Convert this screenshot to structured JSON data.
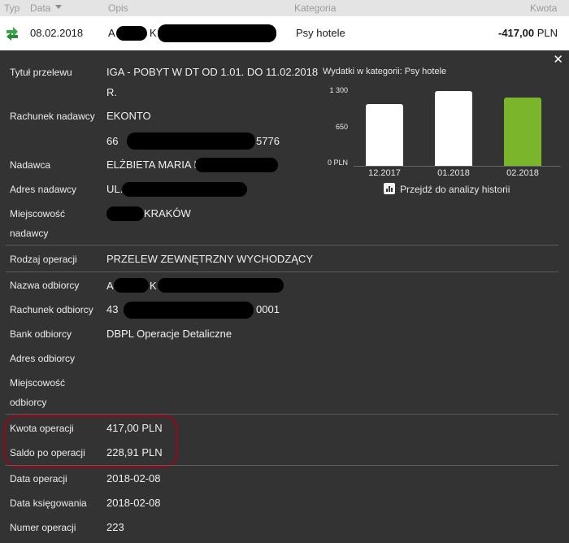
{
  "header": {
    "col_type": "Typ",
    "col_date": "Data",
    "col_desc": "Opis",
    "col_category": "Kategoria",
    "col_amount": "Kwota"
  },
  "transaction": {
    "date": "08.02.2018",
    "desc_start": "A",
    "desc_mid": "K",
    "category": "Psy hotele",
    "amount": "-417,00",
    "currency": "PLN"
  },
  "details": {
    "title_label": "Tytuł przelewu",
    "title_value_line1": "IGA - POBYT W DT OD 1.01. DO 11.02.2018",
    "title_value_line2": "R.",
    "sender_account_label": "Rachunek nadawcy",
    "sender_account_type": "EKONTO",
    "sender_account_prefix": "66",
    "sender_account_suffix": "5776",
    "sender_label": "Nadawca",
    "sender_value": "ELŻBIETA MARIA I",
    "sender_address_label": "Adres nadawcy",
    "sender_address_value": "UL.",
    "sender_city_label_1": "Miejscowość",
    "sender_city_label_2": "nadawcy",
    "sender_city_value": "KRAKÓW",
    "op_type_label": "Rodzaj operacji",
    "op_type_value": "PRZELEW ZEWNĘTRZNY WYCHODZĄCY",
    "recipient_name_label": "Nazwa odbiorcy",
    "recipient_name_a": "A",
    "recipient_name_k": "K",
    "recipient_account_label": "Rachunek odbiorcy",
    "recipient_account_prefix": "43",
    "recipient_account_suffix": "0001",
    "recipient_bank_label": "Bank odbiorcy",
    "recipient_bank_value": "DBPL Operacje Detaliczne",
    "recipient_address_label": "Adres odbiorcy",
    "recipient_city_label_1": "Miejscowość",
    "recipient_city_label_2": "odbiorcy",
    "amount_label": "Kwota operacji",
    "amount_value": "417,00 PLN",
    "balance_label": "Saldo po operacji",
    "balance_value": "228,91 PLN",
    "op_date_label": "Data operacji",
    "op_date_value": "2018-02-08",
    "booking_date_label": "Data księgowania",
    "booking_date_value": "2018-02-08",
    "op_number_label": "Numer operacji",
    "op_number_value": "223"
  },
  "chart_heading": "Wydatki w kategorii:  Psy hotele",
  "history_link": "Przejdź do analizy historii",
  "colors": {
    "highlight": "#7a1424",
    "current_bar": "#7ab52c",
    "other_bars": "#ffffff",
    "category_arrow": "#3aa84c"
  },
  "chart_data": {
    "type": "bar",
    "title": "",
    "categories": [
      "12.2017",
      "01.2018",
      "02.2018"
    ],
    "values": [
      1070,
      1300,
      1180
    ],
    "yticks": [
      "1 300",
      "650",
      "0 PLN"
    ],
    "ylim": [
      0,
      1300
    ],
    "xlabel": "",
    "ylabel": "",
    "grid": false
  }
}
